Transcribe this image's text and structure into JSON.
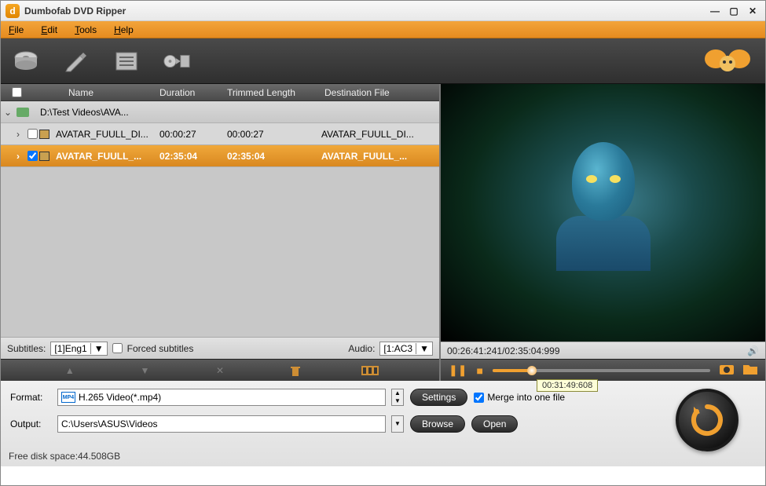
{
  "window": {
    "title": "Dumbofab DVD Ripper"
  },
  "menu": {
    "file": "File",
    "edit": "Edit",
    "tools": "Tools",
    "help": "Help"
  },
  "table": {
    "headers": {
      "name": "Name",
      "duration": "Duration",
      "trimmed": "Trimmed Length",
      "dest": "Destination File"
    },
    "rows": [
      {
        "type": "parent",
        "checked": false,
        "name": "D:\\Test Videos\\AVA...",
        "duration": "",
        "trimmed": "",
        "dest": ""
      },
      {
        "type": "child",
        "checked": false,
        "name": "AVATAR_FUULL_DI...",
        "duration": "00:00:27",
        "trimmed": "00:00:27",
        "dest": "AVATAR_FUULL_DI..."
      },
      {
        "type": "child selected",
        "checked": true,
        "name": "AVATAR_FUULL_...",
        "duration": "02:35:04",
        "trimmed": "02:35:04",
        "dest": "AVATAR_FUULL_..."
      }
    ]
  },
  "subbar": {
    "subtitles_label": "Subtitles:",
    "subtitles_value": "[1]Eng1",
    "forced_label": "Forced subtitles",
    "audio_label": "Audio:",
    "audio_value": "[1:AC3"
  },
  "preview": {
    "time_current": "00:26:41:241",
    "time_total": "02:35:04:999"
  },
  "tooltip": "00:31:49:608",
  "format": {
    "label": "Format:",
    "value": "H.265 Video(*.mp4)",
    "settings_btn": "Settings",
    "merge_label": "Merge into one file"
  },
  "output": {
    "label": "Output:",
    "value": "C:\\Users\\ASUS\\Videos",
    "browse_btn": "Browse",
    "open_btn": "Open"
  },
  "free_space": "Free disk space:44.508GB"
}
